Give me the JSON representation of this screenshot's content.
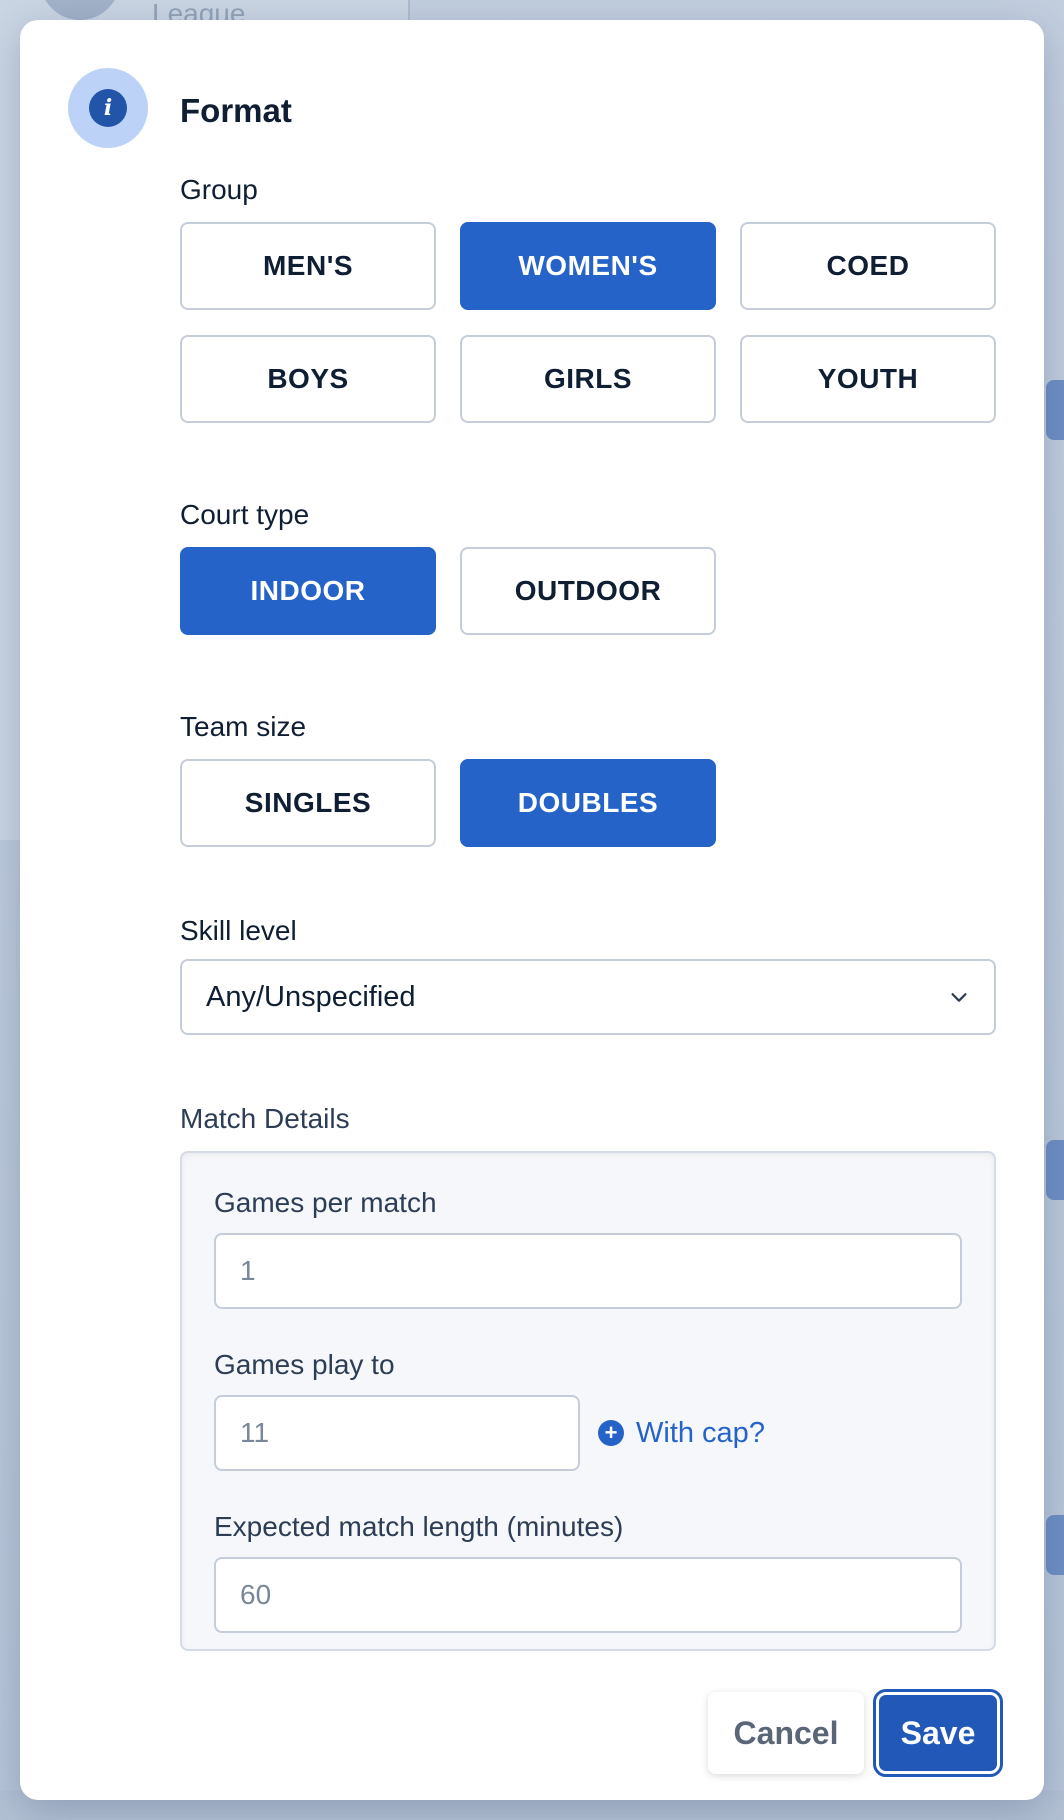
{
  "background": {
    "league_text": "League"
  },
  "modal": {
    "title": "Format",
    "group": {
      "label": "Group",
      "options": [
        "MEN'S",
        "WOMEN'S",
        "COED",
        "BOYS",
        "GIRLS",
        "YOUTH"
      ],
      "selected": "WOMEN'S"
    },
    "court_type": {
      "label": "Court type",
      "options": [
        "INDOOR",
        "OUTDOOR"
      ],
      "selected": "INDOOR"
    },
    "team_size": {
      "label": "Team size",
      "options": [
        "SINGLES",
        "DOUBLES"
      ],
      "selected": "DOUBLES"
    },
    "skill_level": {
      "label": "Skill level",
      "value": "Any/Unspecified"
    },
    "match_details": {
      "label": "Match Details",
      "games_per_match": {
        "label": "Games per match",
        "placeholder": "1"
      },
      "games_play_to": {
        "label": "Games play to",
        "placeholder": "11",
        "cap_link": "With cap?"
      },
      "expected_length": {
        "label": "Expected match length (minutes)",
        "placeholder": "60"
      }
    },
    "footer": {
      "cancel": "Cancel",
      "save": "Save"
    }
  },
  "colors": {
    "accent": "#2563c9",
    "text": "#0f1e33"
  }
}
